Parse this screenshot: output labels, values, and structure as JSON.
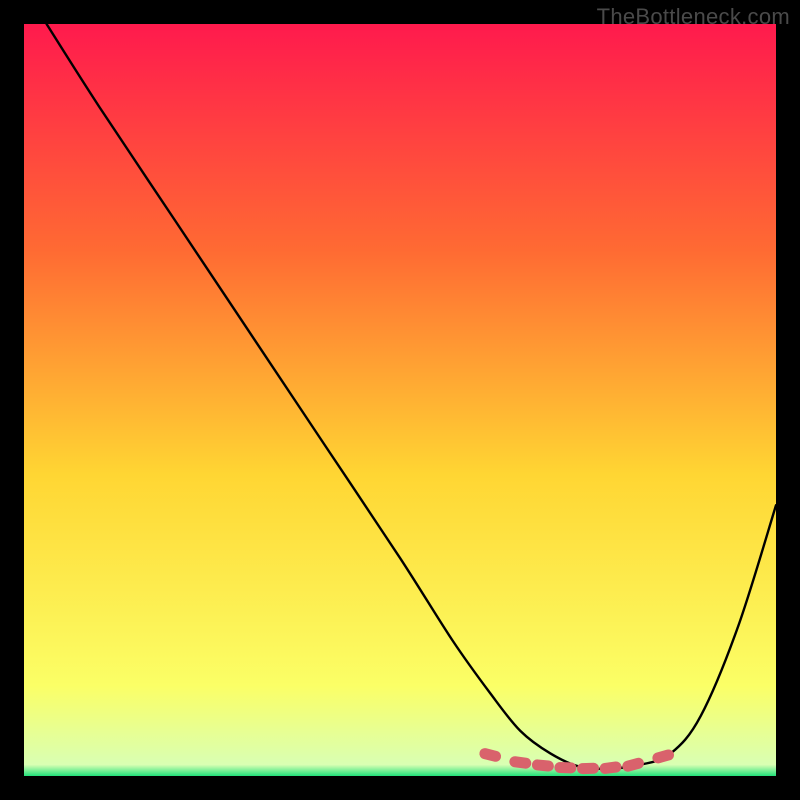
{
  "attribution": "TheBottleneck.com",
  "chart_data": {
    "type": "line",
    "title": "",
    "xlabel": "",
    "ylabel": "",
    "xlim": [
      0,
      100
    ],
    "ylim": [
      0,
      100
    ],
    "background_gradient": {
      "top": "#ff1a4d",
      "mid1": "#ff6a33",
      "mid2": "#ffd633",
      "mid3": "#fbff66",
      "bottom": "#21e07a"
    },
    "series": [
      {
        "name": "bottleneck-curve",
        "x": [
          3,
          10,
          20,
          30,
          40,
          50,
          57,
          62,
          66,
          70,
          74,
          78,
          82,
          86,
          90,
          95,
          100
        ],
        "y": [
          100,
          89,
          74,
          59,
          44,
          29,
          18,
          11,
          6,
          3,
          1.2,
          1,
          1.5,
          3,
          8,
          20,
          36
        ]
      }
    ],
    "optimal_band": {
      "y_min": 0,
      "y_max": 4.5
    },
    "markers": {
      "name": "highlighted-range",
      "color": "#d9626c",
      "points": [
        {
          "x": 62,
          "y": 2.8
        },
        {
          "x": 66,
          "y": 1.8
        },
        {
          "x": 69,
          "y": 1.4
        },
        {
          "x": 72,
          "y": 1.1
        },
        {
          "x": 75,
          "y": 1.0
        },
        {
          "x": 78,
          "y": 1.1
        },
        {
          "x": 81,
          "y": 1.5
        },
        {
          "x": 85,
          "y": 2.6
        }
      ]
    }
  }
}
